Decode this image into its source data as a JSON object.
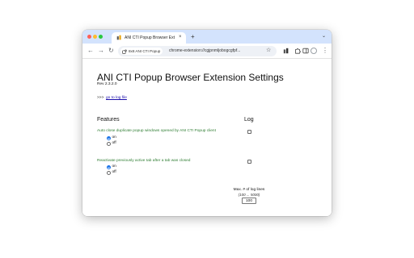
{
  "tab": {
    "title": "ANI CTI Popup Browser Exten",
    "close_glyph": "×",
    "new_tab_glyph": "+"
  },
  "toolbar": {
    "back_glyph": "←",
    "forward_glyph": "→",
    "reload_glyph": "↻",
    "site_chip_label": "8x8 ANI CTI Popup",
    "url": "chrome-extension://cgjpnmljobogcgfpf...",
    "star_glyph": "☆",
    "menu_glyph": "⋮",
    "tab_search_glyph": "⌄"
  },
  "page": {
    "title": "ANI CTI Popup Browser Extension Settings",
    "revision": "Rev 2.3.2.0",
    "log_prefix": ">>>",
    "log_link": "go to log file",
    "features_heading": "Features",
    "log_heading": "Log",
    "features": [
      {
        "label": "Auto close duplicate popup windows opened by ANI CTI Popup client",
        "options": [
          {
            "label": "on",
            "selected": true
          },
          {
            "label": "off",
            "selected": false
          }
        ],
        "log_checked": false
      },
      {
        "label": "Reactivate previously active tab after a tab was closed",
        "options": [
          {
            "label": "on",
            "selected": true
          },
          {
            "label": "off",
            "selected": false
          }
        ],
        "log_checked": false
      }
    ],
    "max_log_label": "Max. # of log lines",
    "max_log_range": "(100 ... 5000)",
    "max_log_value": "100"
  },
  "colors": {
    "tabstrip": "#d3e3fd",
    "feature_label": "#2e7d32",
    "link": "#1a0dab",
    "radio_accent": "#1a73e8"
  }
}
